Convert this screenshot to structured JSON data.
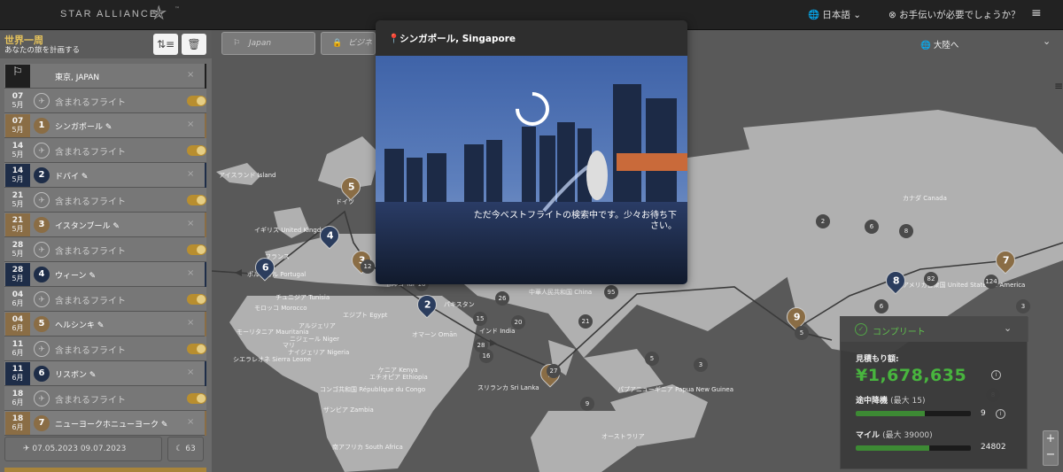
{
  "header": {
    "logo_text": "STAR ALLIANCE",
    "logo_tm": "™",
    "language": "日本語",
    "help": "お手伝いが必要でしょうか？"
  },
  "sidebar": {
    "title": "世界一周",
    "subtitle": "あなたの旅を計画する",
    "rows": [
      {
        "kind": "origin",
        "label": "東京, JAPAN"
      },
      {
        "kind": "flight",
        "day": "07",
        "month": "5月",
        "label": "含まれるフライト"
      },
      {
        "kind": "city",
        "day": "07",
        "month": "5月",
        "num": "1",
        "label": "シンガポール",
        "color": "tan"
      },
      {
        "kind": "flight",
        "day": "14",
        "month": "5月",
        "label": "含まれるフライト"
      },
      {
        "kind": "city",
        "day": "14",
        "month": "5月",
        "num": "2",
        "label": "ドバイ",
        "color": "navy"
      },
      {
        "kind": "flight",
        "day": "21",
        "month": "5月",
        "label": "含まれるフライト"
      },
      {
        "kind": "city",
        "day": "21",
        "month": "5月",
        "num": "3",
        "label": "イスタンブール",
        "color": "tan"
      },
      {
        "kind": "flight",
        "day": "28",
        "month": "5月",
        "label": "含まれるフライト"
      },
      {
        "kind": "city",
        "day": "28",
        "month": "5月",
        "num": "4",
        "label": "ウィーン",
        "color": "navy"
      },
      {
        "kind": "flight",
        "day": "04",
        "month": "6月",
        "label": "含まれるフライト"
      },
      {
        "kind": "city",
        "day": "04",
        "month": "6月",
        "num": "5",
        "label": "ヘルシンキ",
        "color": "tan"
      },
      {
        "kind": "flight",
        "day": "11",
        "month": "6月",
        "label": "含まれるフライト"
      },
      {
        "kind": "city",
        "day": "11",
        "month": "6月",
        "num": "6",
        "label": "リスボン",
        "color": "navy"
      },
      {
        "kind": "flight",
        "day": "18",
        "month": "6月",
        "label": "含まれるフライト"
      },
      {
        "kind": "city",
        "day": "18",
        "month": "6月",
        "num": "7",
        "label": "ニューヨークホニューヨーク",
        "color": "tan"
      }
    ],
    "date_range": "07.05.2023     09.07.2023",
    "nights": "63"
  },
  "map": {
    "filters": [
      "Japan",
      "ビジネス"
    ],
    "continent_button": "大陸へ",
    "labels": [
      "アイスランド Island",
      "イギリス United Kingdom",
      "ドイツ",
      "ポルトガル Portugal",
      "フランス",
      "チュニジア Tunisia",
      "モロッコ Morocco",
      "アルジェリア",
      "モーリタニア Mauritania",
      "マリ",
      "ニジェール Niger",
      "ナイジェリア Nigeria",
      "シエラレオネ Sierra Leone",
      "エジプト Egypt",
      "エチオピア Ethiopia",
      "ケニア Kenya",
      "コンゴ共和国 République du Congo",
      "ザンビア Zambia",
      "南アフリカ South Africa",
      "トルコ Türkiye",
      "オマーン Omān",
      "パキスタン",
      "インド India",
      "スリランカ Sri Lanka",
      "中華人民共和国 China",
      "パプアニューギニア Papua New Guinea",
      "オーストラリア",
      "カナダ Canada",
      "アメリカ合衆国 United States of America"
    ],
    "markers": [
      "1",
      "2",
      "3",
      "4",
      "5",
      "6",
      "7",
      "8",
      "9"
    ],
    "clusters": [
      "12",
      "26",
      "16",
      "21",
      "15",
      "27",
      "9",
      "28",
      "20",
      "95",
      "16",
      "6",
      "5",
      "8",
      "6",
      "124",
      "82",
      "8",
      "5",
      "3",
      "2",
      "3"
    ]
  },
  "popup": {
    "title": "シンガポール, Singapore",
    "message": "ただ今ベストフライトの検索中です。少々お待ち下さい。"
  },
  "summary": {
    "status": "コンプリート",
    "estimate_label": "見積もり額:",
    "estimate_value": "¥1,678,635",
    "stopovers_label": "途中降機",
    "stopovers_max": "(最大 15)",
    "stopovers_value": "9",
    "stopovers_fraction": 0.6,
    "miles_label": "マイル",
    "miles_max": "(最大 39000)",
    "miles_value": "24802",
    "miles_fraction": 0.636
  },
  "colors": {
    "accent_gold": "#b88e2f",
    "tan": "#8a6d45",
    "navy": "#1e2d48",
    "green": "#48b53e"
  }
}
